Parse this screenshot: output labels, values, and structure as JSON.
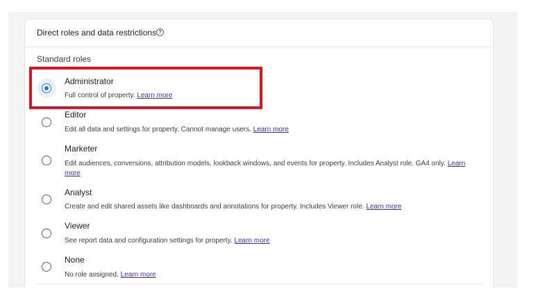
{
  "section": {
    "title": "Direct roles and data restrictions",
    "help_icon": "help-circle-icon",
    "standard_roles_label": "Standard roles"
  },
  "roles": [
    {
      "name": "Administrator",
      "description": "Full control of property.",
      "link": "Learn more",
      "selected": true
    },
    {
      "name": "Editor",
      "description": "Edit all data and settings for property. Cannot manage users.",
      "link": "Learn more",
      "selected": false
    },
    {
      "name": "Marketer",
      "description": "Edit audiences, conversions, attribution models, lookback windows, and events for property. Includes Analyst role. GA4 only.",
      "link": "Learn more",
      "selected": false
    },
    {
      "name": "Analyst",
      "description": "Create and edit shared assets like dashboards and annotations for property. Includes Viewer role.",
      "link": "Learn more",
      "selected": false
    },
    {
      "name": "Viewer",
      "description": "See report data and configuration settings for property.",
      "link": "Learn more",
      "selected": false
    },
    {
      "name": "None",
      "description": "No role assigned.",
      "link": "Learn more",
      "selected": false
    }
  ],
  "colors": {
    "accent": "#1a73e8",
    "highlight": "#e0121f",
    "link": "#4a25c9"
  }
}
